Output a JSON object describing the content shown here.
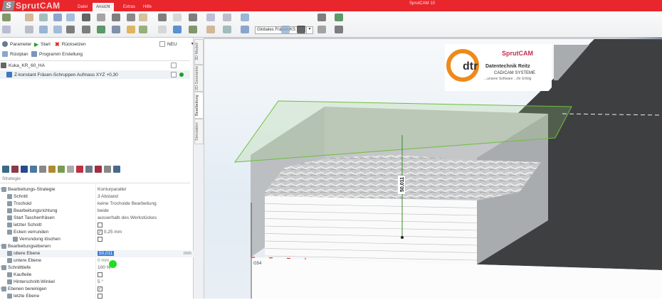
{
  "app": {
    "logo_text": "SprutCAM",
    "window_title": "SprutCAM 10",
    "brand_color": "#e8262b"
  },
  "menu": {
    "tabs": [
      {
        "label": "Datei"
      },
      {
        "label": "Ansicht",
        "active": true
      },
      {
        "label": "Extras"
      },
      {
        "label": "Hilfe"
      }
    ]
  },
  "toolbar": {
    "coordinate_system": "Globales Fräsen-KS"
  },
  "operations": {
    "parameter": "Parameter",
    "start": "Start",
    "reset": "Rücksetzen",
    "new": "NEU",
    "setup_sheet": "Rüstplan",
    "program_creation": "Programm Erstellung"
  },
  "tree": [
    {
      "label": "Kuka_KR_60_HA"
    },
    {
      "label": "Z-konstant Fräsen-Schruppen Aufmass XYZ +0,30",
      "status": "#1aa31a"
    }
  ],
  "vertical_tabs": [
    {
      "label": "3D Modell"
    },
    {
      "label": "2D Geometrie"
    },
    {
      "label": "Bearbeitung",
      "active": true
    },
    {
      "label": "Simulation"
    }
  ],
  "properties": {
    "section_title": "Strategie",
    "rows": [
      {
        "label": "Bearbeitungs-Strategie",
        "value": "Konturparallel",
        "level": 0,
        "section": true
      },
      {
        "label": "Schnitt",
        "value": "3 Abstand",
        "level": 1
      },
      {
        "label": "Trochoid",
        "value": "keine Trochoide Bearbeitung",
        "level": 1
      },
      {
        "label": "Bearbeitungsrichtung",
        "value": "beide",
        "level": 1
      },
      {
        "label": "Start Taschenfräsen",
        "value": "ausserhalb des Werkstückes",
        "level": 1
      },
      {
        "label": "letzter Schnitt",
        "checkbox": false,
        "level": 1
      },
      {
        "label": "Ecken verrunden",
        "checkbox": true,
        "value": "0,25 mm",
        "level": 1
      },
      {
        "label": "Verrundung löschen",
        "checkbox": false,
        "level": 2
      },
      {
        "label": "Bearbeitungsebenen",
        "level": 0,
        "section": true
      },
      {
        "label": "obere Ebene",
        "value": "50,011",
        "unit": "mm",
        "help": "?",
        "level": 1,
        "editing": true
      },
      {
        "label": "untere Ebene",
        "value": "0 mm",
        "level": 1
      },
      {
        "label": "Schnitttiefe",
        "value": "100 %",
        "level": 0,
        "section": true
      },
      {
        "label": "Kaufteile",
        "checkbox": false,
        "level": 1
      },
      {
        "label": "Hinterschnitt-Winkel",
        "value": "5 °",
        "level": 1
      },
      {
        "label": "Ebenen bereinigen",
        "checkbox": true,
        "level": 0,
        "section": true
      },
      {
        "label": "letzte Ebene",
        "checkbox": false,
        "level": 1
      }
    ]
  },
  "viewport": {
    "dimension": "50,011",
    "origin_label": "G54",
    "banner": {
      "brand": "SprutCAM",
      "company": "Datentechnik Reitz",
      "subtitle": "CAD/CAM SYSTEME",
      "tagline": "...unsere Software ...Ihr Erfolg",
      "logo": "dtr"
    }
  }
}
